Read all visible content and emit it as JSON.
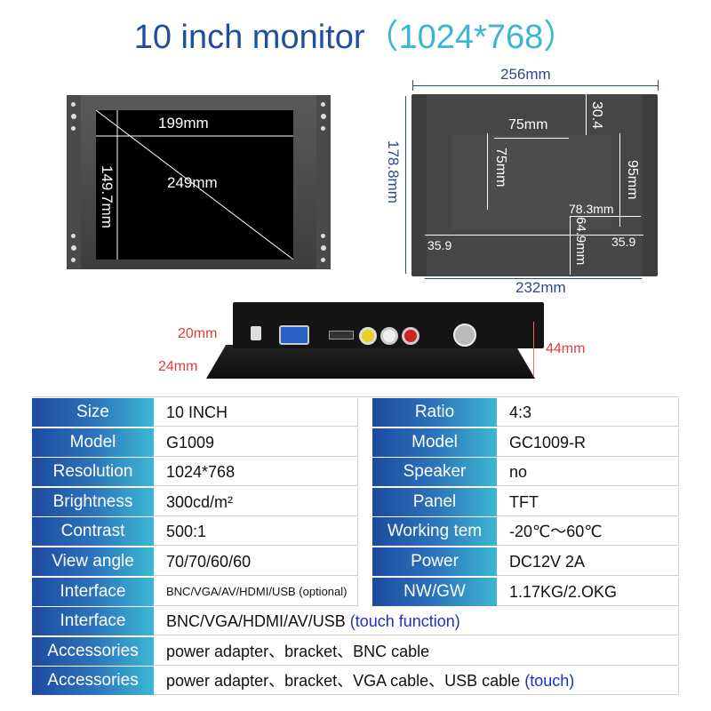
{
  "title": {
    "main": "10 inch monitor",
    "resolution": "（1024*768）"
  },
  "front_view": {
    "width_label": "199mm",
    "diagonal_label": "249mm",
    "height_label": "149.7mm"
  },
  "back_view": {
    "total_width": "256mm",
    "total_height": "178.8mm",
    "bottom_width": "232mm",
    "vesa_horizontal": "75mm",
    "vesa_vertical": "75mm",
    "top_offset": "30.4",
    "box_height": "95mm",
    "port_width": "78.3mm",
    "port_offset": "64.9mm",
    "left_offset": "35.9",
    "right_offset": "35.9"
  },
  "side_view": {
    "box_depth": "20mm",
    "panel_depth": "24mm",
    "total_depth": "44mm"
  },
  "colors": {
    "title_dark": "#1f4fa0",
    "title_light": "#3bb6d2",
    "dim_blue": "#2c4a8a",
    "dim_red": "#e23b3b",
    "label_grad_start": "#1d4aa0",
    "label_grad_end": "#3db7d4",
    "highlight_blue": "#1a2fd0"
  },
  "spec_table": {
    "left": [
      {
        "label": "Size",
        "value": "10 INCH"
      },
      {
        "label": "Model",
        "value": "G1009"
      },
      {
        "label": "Resolution",
        "value": "1024*768"
      },
      {
        "label": "Brightness",
        "value": "300cd/m²"
      },
      {
        "label": "Contrast",
        "value": "500:1"
      },
      {
        "label": "View angle",
        "value": "70/70/60/60"
      },
      {
        "label": "Interface",
        "value": "BNC/VGA/AV/HDMI/USB (optional)"
      }
    ],
    "right": [
      {
        "label": "Ratio",
        "value": "4:3"
      },
      {
        "label": "Model",
        "value": "GC1009-R"
      },
      {
        "label": "Speaker",
        "value": "no"
      },
      {
        "label": "Panel",
        "value": "TFT"
      },
      {
        "label": "Working tem",
        "value": "-20℃～60℃"
      },
      {
        "label": "Power",
        "value": "DC12V  2A"
      },
      {
        "label": "NW/GW",
        "value": "1.17KG/2.OKG"
      }
    ],
    "full": [
      {
        "label": "Interface",
        "value": "BNC/VGA/HDMI/AV/USB ",
        "note": "(touch function)"
      },
      {
        "label": "Accessories",
        "value": "power adapter、bracket、BNC cable",
        "note": ""
      },
      {
        "label": "Accessories",
        "value": "power adapter、bracket、VGA cable、USB cable ",
        "note": "(touch)"
      }
    ]
  }
}
